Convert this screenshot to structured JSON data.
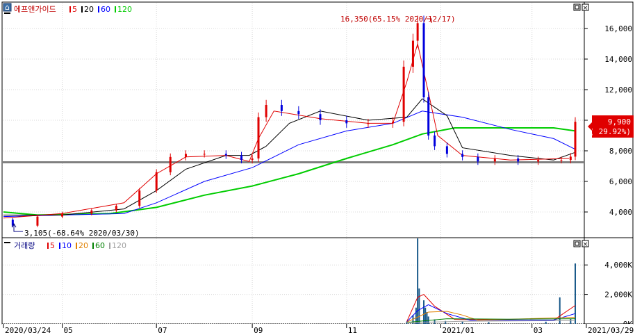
{
  "price_panel": {
    "title": "에프앤가이드",
    "ma_legend": [
      {
        "label": "5",
        "color": "#e00000"
      },
      {
        "label": "20",
        "color": "#000000"
      },
      {
        "label": "60",
        "color": "#0000ff"
      },
      {
        "label": "120",
        "color": "#00cc00"
      }
    ],
    "y_ticks": [
      "16,000",
      "14,000",
      "12,000",
      "10,000",
      "8,000",
      "6,000",
      "4,000"
    ],
    "high_annotation": "16,350(65.15% 2020/12/17)",
    "low_annotation": "3,105(-68.64% 2020/03/30)",
    "last_price": "9,900",
    "last_change": "( 29.92%)"
  },
  "volume_panel": {
    "title": "거래량",
    "ma_legend": [
      {
        "label": "5",
        "color": "#e00000"
      },
      {
        "label": "10",
        "color": "#0000ff"
      },
      {
        "label": "20",
        "color": "#e08000"
      },
      {
        "label": "60",
        "color": "#008000"
      },
      {
        "label": "120",
        "color": "#a0a0a0"
      }
    ],
    "y_ticks": [
      "4,000K",
      "2,000K",
      "0K"
    ]
  },
  "x_axis": {
    "labels": [
      "2020/03/24",
      "05",
      "07",
      "09",
      "11",
      "2021/01",
      "03",
      "2021/03/29"
    ]
  },
  "colors": {
    "up": "#e00000",
    "down": "#0000dd",
    "ma5": "#e00000",
    "ma20": "#000000",
    "ma60": "#0000ff",
    "ma120": "#00cc00",
    "hline": "#808080",
    "grid": "#d8d8d8"
  },
  "chart_data": [
    {
      "type": "candlestick",
      "title": "에프앤가이드",
      "ylim": [
        2500,
        17500
      ],
      "y_ticks": [
        4000,
        6000,
        8000,
        10000,
        12000,
        14000,
        16000
      ],
      "horizontal_line": 7250,
      "x_range": [
        "2020/03/24",
        "2021/03/29"
      ],
      "close_series": {
        "dates": [
          "2020/03/24",
          "2020/03/30",
          "2020/04/15",
          "2020/05/01",
          "2020/05/20",
          "2020/06/05",
          "2020/06/20",
          "2020/07/01",
          "2020/07/10",
          "2020/07/20",
          "2020/08/01",
          "2020/08/15",
          "2020/08/25",
          "2020/09/01",
          "2020/09/05",
          "2020/09/10",
          "2020/09/20",
          "2020/10/01",
          "2020/10/15",
          "2020/11/01",
          "2020/11/15",
          "2020/12/01",
          "2020/12/08",
          "2020/12/14",
          "2020/12/17",
          "2020/12/21",
          "2020/12/24",
          "2020/12/28",
          "2021/01/05",
          "2021/01/15",
          "2021/01/25",
          "2021/02/05",
          "2021/02/20",
          "2021/03/05",
          "2021/03/20",
          "2021/03/26",
          "2021/03/29"
        ],
        "values": [
          3500,
          3105,
          3700,
          3900,
          4100,
          4400,
          5400,
          6600,
          7600,
          7800,
          7800,
          7700,
          7400,
          7500,
          10200,
          11000,
          10600,
          10400,
          10000,
          9800,
          9800,
          9900,
          13500,
          15200,
          16350,
          11500,
          9000,
          8300,
          7800,
          7600,
          7300,
          7500,
          7300,
          7400,
          7400,
          7620,
          9900
        ]
      },
      "moving_averages": [
        {
          "name": "5",
          "dates": [
            "2020/03/24",
            "2020/05/01",
            "2020/06/10",
            "2020/07/01",
            "2020/07/20",
            "2020/08/15",
            "2020/08/30",
            "2020/09/05",
            "2020/09/15",
            "2020/10/15",
            "2020/11/15",
            "2020/12/01",
            "2020/12/10",
            "2020/12/17",
            "2020/12/24",
            "2020/12/30",
            "2021/01/15",
            "2021/02/15",
            "2021/03/25"
          ],
          "values": [
            3600,
            3900,
            4600,
            6500,
            7600,
            7700,
            7300,
            8800,
            10600,
            10100,
            9800,
            9800,
            12500,
            15000,
            11800,
            9000,
            7700,
            7400,
            7500
          ]
        },
        {
          "name": "20",
          "dates": [
            "2020/03/24",
            "2020/05/01",
            "2020/06/10",
            "2020/07/01",
            "2020/07/20",
            "2020/08/15",
            "2020/08/30",
            "2020/09/10",
            "2020/09/25",
            "2020/10/15",
            "2020/11/15",
            "2020/12/10",
            "2020/12/20",
            "2021/01/05",
            "2021/01/15",
            "2021/02/15",
            "2021/03/15",
            "2021/03/29"
          ],
          "values": [
            3800,
            3800,
            4200,
            5400,
            6800,
            7700,
            7700,
            8300,
            9800,
            10600,
            10000,
            10200,
            11400,
            10300,
            8200,
            7700,
            7400,
            7900
          ]
        },
        {
          "name": "60",
          "dates": [
            "2020/03/24",
            "2020/05/01",
            "2020/06/10",
            "2020/07/01",
            "2020/08/01",
            "2020/09/01",
            "2020/10/01",
            "2020/11/01",
            "2020/12/01",
            "2020/12/20",
            "2021/01/15",
            "2021/02/15",
            "2021/03/15",
            "2021/03/29"
          ],
          "values": [
            3700,
            3800,
            3900,
            4600,
            6000,
            6900,
            8400,
            9300,
            9800,
            10600,
            10200,
            9400,
            8800,
            8100
          ]
        },
        {
          "name": "120",
          "dates": [
            "2020/03/24",
            "2020/04/15",
            "2020/06/01",
            "2020/07/01",
            "2020/08/01",
            "2020/09/01",
            "2020/10/01",
            "2020/11/01",
            "2020/12/01",
            "2020/12/20",
            "2021/01/10",
            "2021/02/15",
            "2021/03/15",
            "2021/03/29"
          ],
          "values": [
            4000,
            3800,
            3900,
            4300,
            5100,
            5700,
            6500,
            7500,
            8400,
            9100,
            9500,
            9500,
            9500,
            9300
          ]
        }
      ],
      "annotations": [
        {
          "text": "16,350(65.15% 2020/12/17)",
          "date": "2020/12/17",
          "value": 16350
        },
        {
          "text": "3,105(-68.64% 2020/03/30)",
          "date": "2020/03/30",
          "value": 3105
        }
      ],
      "last": {
        "price": 9900,
        "change_pct": 29.92
      }
    },
    {
      "type": "bar",
      "title": "거래량",
      "unit": "K",
      "ylim": [
        0,
        5000
      ],
      "y_ticks": [
        0,
        2000,
        4000
      ],
      "bars": {
        "dates": [
          "2020/12/10",
          "2020/12/14",
          "2020/12/16",
          "2020/12/17",
          "2020/12/18",
          "2020/12/21",
          "2020/12/22",
          "2020/12/23",
          "2020/12/24",
          "2020/12/28",
          "2021/01/04",
          "2021/01/15",
          "2021/02/01",
          "2021/03/10",
          "2021/03/19",
          "2021/03/26",
          "2021/03/29"
        ],
        "values": [
          150,
          600,
          1100,
          5800,
          2400,
          1600,
          1100,
          800,
          500,
          300,
          200,
          150,
          120,
          150,
          1800,
          350,
          4100
        ]
      },
      "moving_averages": [
        {
          "name": "5",
          "dates": [
            "2020/12/10",
            "2020/12/17",
            "2020/12/21",
            "2020/12/28",
            "2021/01/10",
            "2021/03/15",
            "2021/03/29"
          ],
          "values": [
            150,
            1800,
            2000,
            1200,
            300,
            250,
            1250
          ]
        },
        {
          "name": "10",
          "dates": [
            "2020/12/10",
            "2020/12/17",
            "2020/12/24",
            "2021/01/05",
            "2021/01/20",
            "2021/03/15",
            "2021/03/29"
          ],
          "values": [
            130,
            900,
            1300,
            700,
            250,
            260,
            700
          ]
        },
        {
          "name": "20",
          "dates": [
            "2020/12/10",
            "2020/12/24",
            "2021/01/05",
            "2021/01/15",
            "2021/01/25",
            "2021/03/29"
          ],
          "values": [
            120,
            800,
            850,
            600,
            250,
            450
          ]
        },
        {
          "name": "60",
          "dates": [
            "2020/12/10",
            "2021/01/05",
            "2021/02/15",
            "2021/03/29"
          ],
          "values": [
            100,
            350,
            320,
            350
          ]
        },
        {
          "name": "120",
          "dates": [
            "2020/12/10",
            "2021/01/15",
            "2021/03/29"
          ],
          "values": [
            80,
            180,
            220
          ]
        }
      ]
    }
  ]
}
